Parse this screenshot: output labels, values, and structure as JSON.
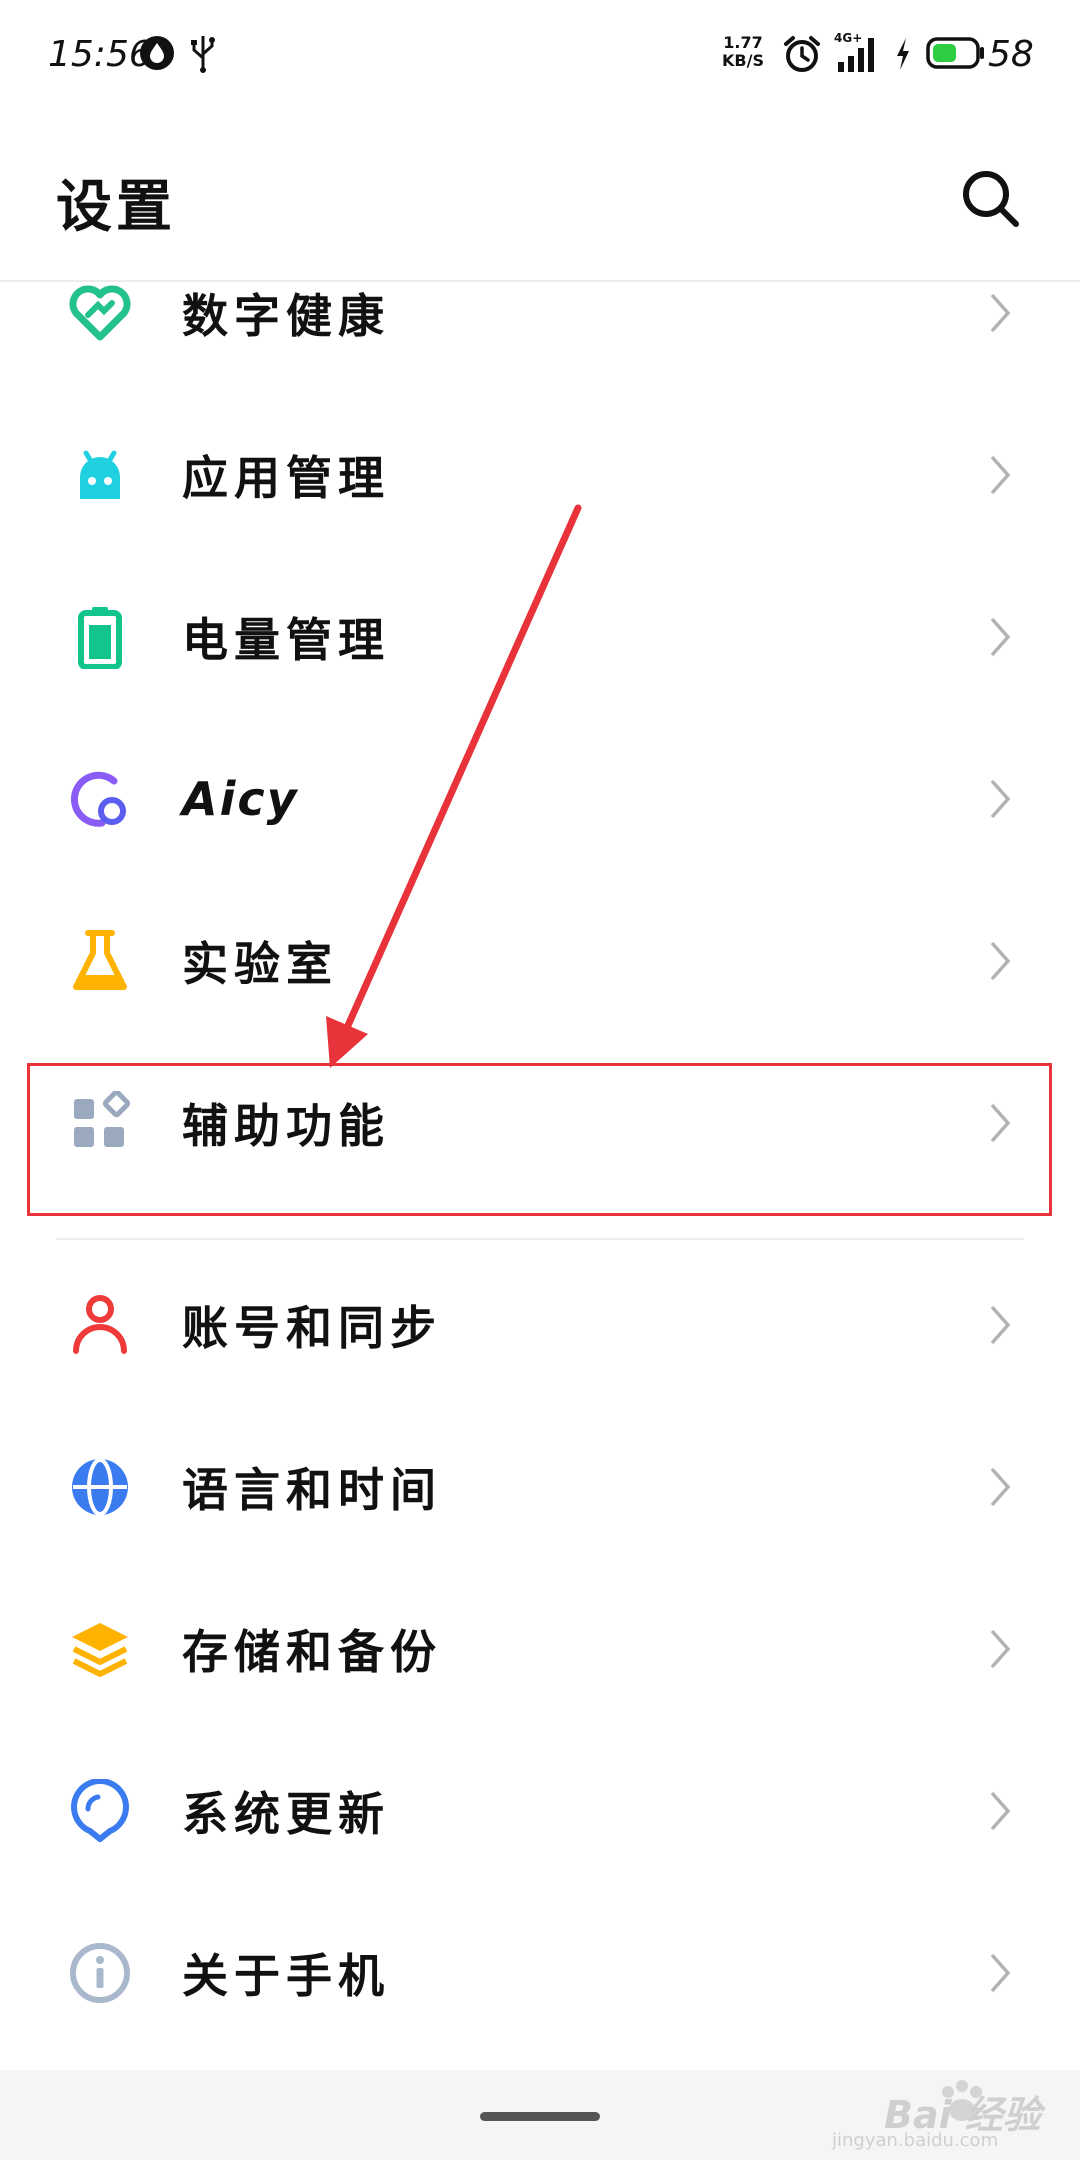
{
  "status_bar": {
    "time": "15:56",
    "net_speed": "1.77",
    "net_unit": "KB/S",
    "signal_label": "4G+",
    "battery_level": "58",
    "battery_fraction": 0.58,
    "battery_color": "#2ecc40"
  },
  "header": {
    "title": "设置"
  },
  "settings": [
    {
      "label": "数字健康",
      "icon": "heart-icon",
      "color": "#22c28a"
    },
    {
      "label": "应用管理",
      "icon": "android-icon",
      "color": "#1fd0e0"
    },
    {
      "label": "电量管理",
      "icon": "battery-icon",
      "color": "#13c58d"
    },
    {
      "label": "Aicy",
      "icon": "aicy-icon",
      "color": "#8a5cf6"
    },
    {
      "label": "实验室",
      "icon": "flask-icon",
      "color": "#ffb300"
    },
    {
      "label": "辅助功能",
      "icon": "grid-icon",
      "color": "#9aa9bd",
      "highlighted": true
    },
    {
      "label": "账号和同步",
      "icon": "person-icon",
      "color": "#ef3a3a"
    },
    {
      "label": "语言和时间",
      "icon": "globe-icon",
      "color": "#3b7bf0"
    },
    {
      "label": "存储和备份",
      "icon": "layers-icon",
      "color": "#ffb300"
    },
    {
      "label": "系统更新",
      "icon": "update-icon",
      "color": "#3b7bf0"
    },
    {
      "label": "关于手机",
      "icon": "info-icon",
      "color": "#a9b8cc"
    }
  ],
  "annotation_color": "#e8333a",
  "watermark": {
    "brand": "Bai 经验",
    "url": "jingyan.baidu.com"
  }
}
